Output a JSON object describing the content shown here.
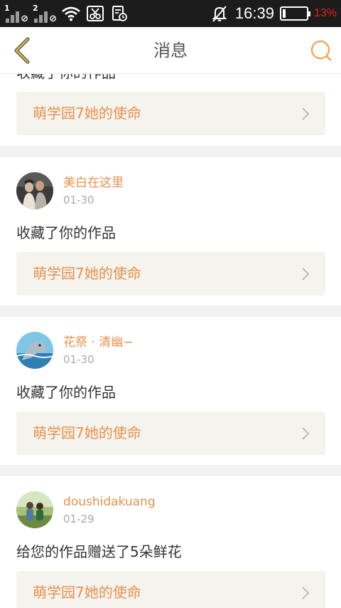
{
  "status_bar": {
    "sim1": "1",
    "sim2": "2",
    "time": "16:39",
    "battery_percent": "13%",
    "battery_level": 0.13
  },
  "header": {
    "title": "消息"
  },
  "notifications": [
    {
      "action": "收藏了你的作品",
      "work_title": "萌学园7她的使命"
    },
    {
      "username": "美白在这里",
      "date": "01-30",
      "action": "收藏了你的作品",
      "work_title": "萌学园7她的使命"
    },
    {
      "username": "花祭 · 清幽−",
      "date": "01-30",
      "action": "收藏了你的作品",
      "work_title": "萌学园7她的使命"
    },
    {
      "username": "doushidakuang",
      "date": "01-29",
      "action": "给您的作品赠送了5朵鲜花",
      "work_title": "萌学园7她的使命"
    }
  ],
  "colors": {
    "accent": "#e8914e",
    "status_bar_bg": "#1c1c1c",
    "battery_low": "#e02020"
  }
}
